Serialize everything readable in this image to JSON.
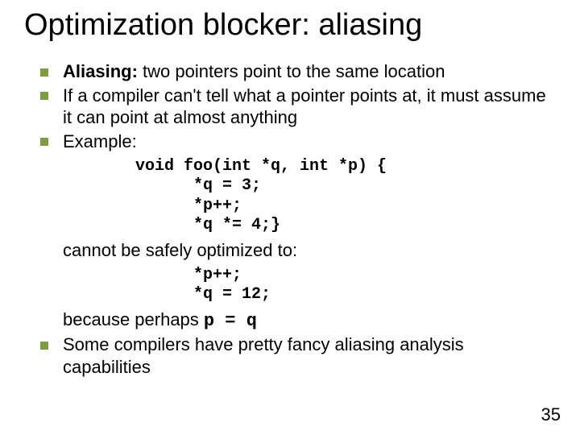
{
  "title": "Optimization blocker: aliasing",
  "bullets": {
    "b1": {
      "term": "Aliasing:",
      "rest": "  two pointers point to the same location"
    },
    "b2": "If a compiler can't tell what a pointer points at, it must assume it can point at almost anything",
    "b3": "Example:",
    "code1_l1": "void foo(int *q, int *p) {",
    "code1_l2": "      *q = 3;",
    "code1_l3": "      *p++;",
    "code1_l4": "      *q *= 4;}",
    "mid1": "cannot be safely optimized to:",
    "code2_l1": "      *p++;",
    "code2_l2": "      *q = 12;",
    "mid2_pre": "because perhaps ",
    "mid2_code": "p = q",
    "b4": "Some compilers have pretty fancy aliasing analysis capabilities"
  },
  "page_number": "35"
}
